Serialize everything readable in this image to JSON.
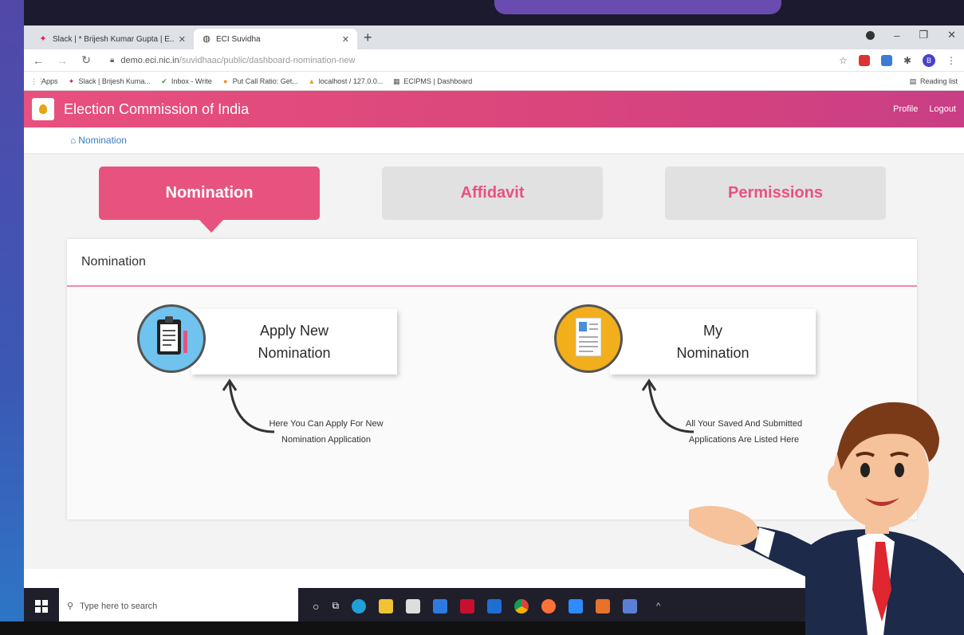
{
  "browser": {
    "tabs": [
      {
        "title": "Slack | * Brijesh Kumar Gupta | E...",
        "favicon": "slack-icon",
        "active": false
      },
      {
        "title": "ECI Suvidha",
        "favicon": "globe-icon",
        "active": true
      }
    ],
    "address": {
      "domain": "demo.eci.nic.in",
      "path": "/suvidhaac/public/dashboard-nomination-new"
    },
    "bookmarks": [
      {
        "label": "Apps",
        "icon": "apps-icon"
      },
      {
        "label": "Slack | Brijesh Kuma...",
        "icon": "slack-icon"
      },
      {
        "label": "Inbox - Write",
        "icon": "check-icon"
      },
      {
        "label": "Put Call Ratio: Get...",
        "icon": "orange-dot-icon"
      },
      {
        "label": "localhost / 127.0.0...",
        "icon": "db-icon"
      },
      {
        "label": "ECIPMS | Dashboard",
        "icon": "dashboard-icon"
      }
    ],
    "reading_list": "Reading list",
    "profile_initial": "B"
  },
  "app": {
    "title": "Election Commission of India",
    "links": {
      "profile": "Profile",
      "logout": "Logout"
    },
    "breadcrumb": "Nomination",
    "tabs": [
      "Nomination",
      "Affidavit",
      "Permissions"
    ],
    "panel_title": "Nomination",
    "cards": [
      {
        "title_line1": "Apply New",
        "title_line2": "Nomination",
        "hint_line1": "Here You Can Apply For New",
        "hint_line2": "Nomination Application",
        "icon": "clipboard-icon"
      },
      {
        "title_line1": "My",
        "title_line2": "Nomination",
        "hint_line1": "All Your Saved And Submitted",
        "hint_line2": "Applications Are Listed Here",
        "icon": "document-icon"
      }
    ]
  },
  "taskbar": {
    "search_placeholder": "Type here to search"
  },
  "colors": {
    "accent": "#e8527f",
    "header_gradient_start": "#e8507e",
    "header_gradient_end": "#c93e86",
    "inactive_tab": "#e1e1e1"
  }
}
